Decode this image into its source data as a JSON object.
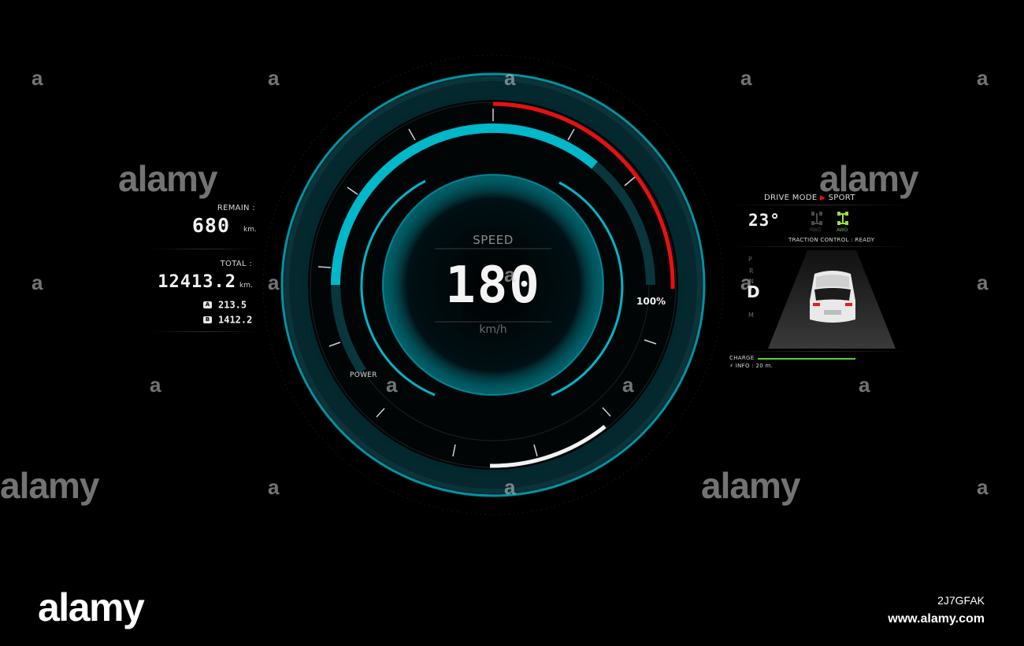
{
  "left_panel": {
    "remain_label": "REMAIN :",
    "remain_value": "680",
    "remain_unit": "km.",
    "total_label": "TOTAL :",
    "total_value": "12413.2",
    "total_unit": "km.",
    "trip_a_badge": "A",
    "trip_a_value": "213.5",
    "trip_b_badge": "B",
    "trip_b_value": "1412.2"
  },
  "gauge": {
    "speed_label": "SPEED",
    "speed_value": "180",
    "speed_unit": "km/h",
    "power_label": "POWER",
    "power_percent_label": "100%"
  },
  "right_panel": {
    "drive_mode_label": "DRIVE MODE",
    "drive_mode_value": "SPORT",
    "temperature": "23°",
    "rwd_label": "RWD",
    "awd_label": "AWD",
    "traction_control": "TRACTION CONTROL : READY",
    "gear_p": "P",
    "gear_r": "R",
    "gear_n": "N",
    "gear_d": "D",
    "gear_m": "M",
    "charge_label": "CHARGE",
    "charge_level": 1.0,
    "info_text": "INFO : 20 m."
  },
  "watermark": {
    "logo_text": "alamy",
    "small_mark": "a",
    "image_id": "2J7GFAK",
    "url": "www.alamy.com"
  },
  "colors": {
    "accent_teal": "#00c2d4",
    "redline": "#e81010",
    "charge_green": "#52d23a",
    "awd_active": "#9adf3c"
  }
}
